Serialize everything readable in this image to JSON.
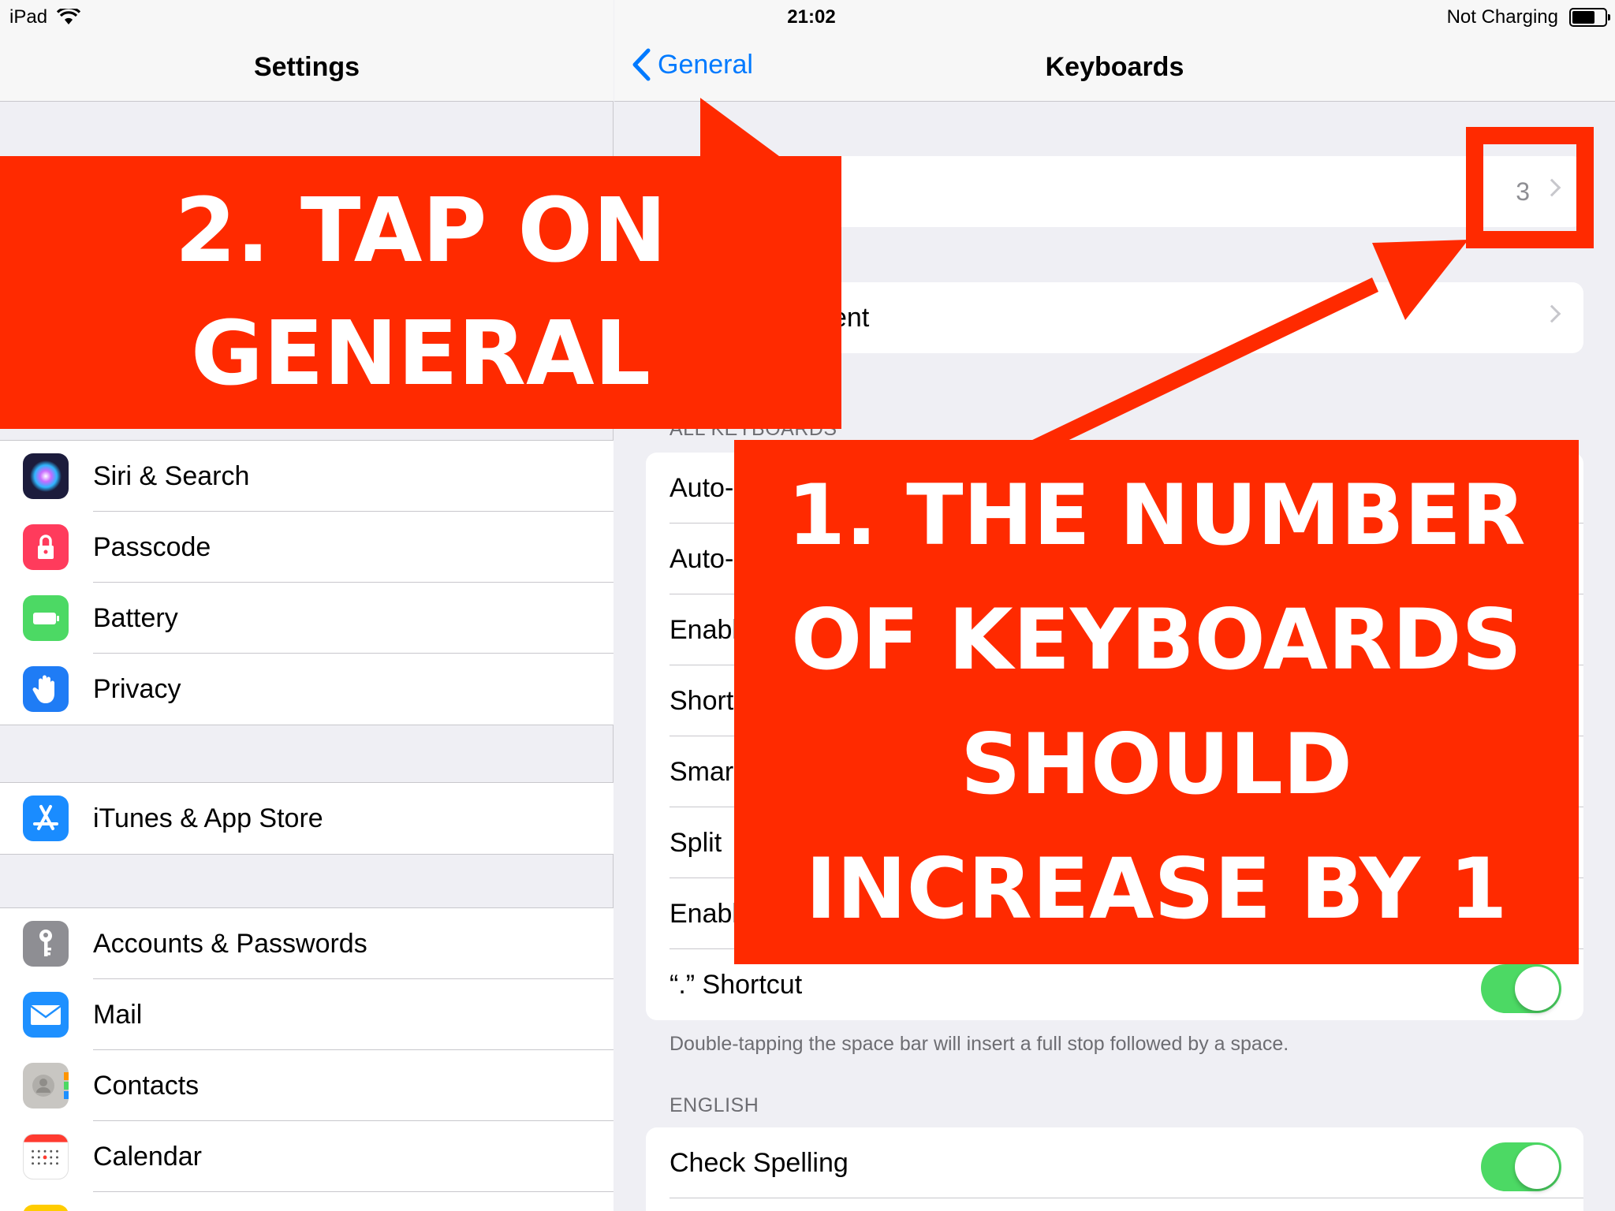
{
  "status_bar": {
    "device": "iPad",
    "time": "21:02",
    "battery_text": "Not Charging"
  },
  "master": {
    "title": "Settings",
    "groups": [
      {
        "items": [
          {
            "label": "Siri & Search",
            "icon": "siri-icon"
          },
          {
            "label": "Passcode",
            "icon": "lock-icon"
          },
          {
            "label": "Battery",
            "icon": "battery-icon"
          },
          {
            "label": "Privacy",
            "icon": "hand-icon"
          }
        ]
      },
      {
        "items": [
          {
            "label": "iTunes & App Store",
            "icon": "app-store-icon"
          }
        ]
      },
      {
        "items": [
          {
            "label": "Accounts & Passwords",
            "icon": "key-icon"
          },
          {
            "label": "Mail",
            "icon": "envelope-icon"
          },
          {
            "label": "Contacts",
            "icon": "contacts-icon"
          },
          {
            "label": "Calendar",
            "icon": "calendar-icon"
          }
        ]
      }
    ]
  },
  "detail": {
    "back_label": "General",
    "title": "Keyboards",
    "keyboards_count": "3",
    "hardware_row_label": "ent",
    "all_keyboards_header": "ALL KEYBOARDS",
    "all_keyboards_rows": [
      "Auto-",
      "Auto-",
      "Enabl",
      "Short",
      "Smar",
      "Split ",
      "Enabl"
    ],
    "shortcut_label": "“.” Shortcut",
    "shortcut_footer": "Double-tapping the space bar will insert a full stop followed by a space.",
    "english_header": "ENGLISH",
    "check_spelling_label": "Check Spelling",
    "toggles": {
      "shortcut_on": true,
      "check_spelling_on": true
    }
  },
  "annotations": {
    "step2_line1": "2. TAP ON",
    "step2_line2": "GENERAL",
    "step1_line1": "1. THE NUMBER",
    "step1_line2": "OF KEYBOARDS",
    "step1_line3": "SHOULD",
    "step1_line4": "INCREASE BY 1",
    "color": "#ff2a00"
  },
  "colors": {
    "ios_blue": "#007aff",
    "toggle_green": "#4cd964",
    "siri": "#1c1c3c",
    "passcode": "#ff3b5c",
    "battery": "#4cd964",
    "privacy": "#1f7cf5",
    "app_store": "#1a8cff",
    "accounts": "#8e8e93",
    "mail": "#1e90ff",
    "contacts": "#c8c6c2"
  }
}
